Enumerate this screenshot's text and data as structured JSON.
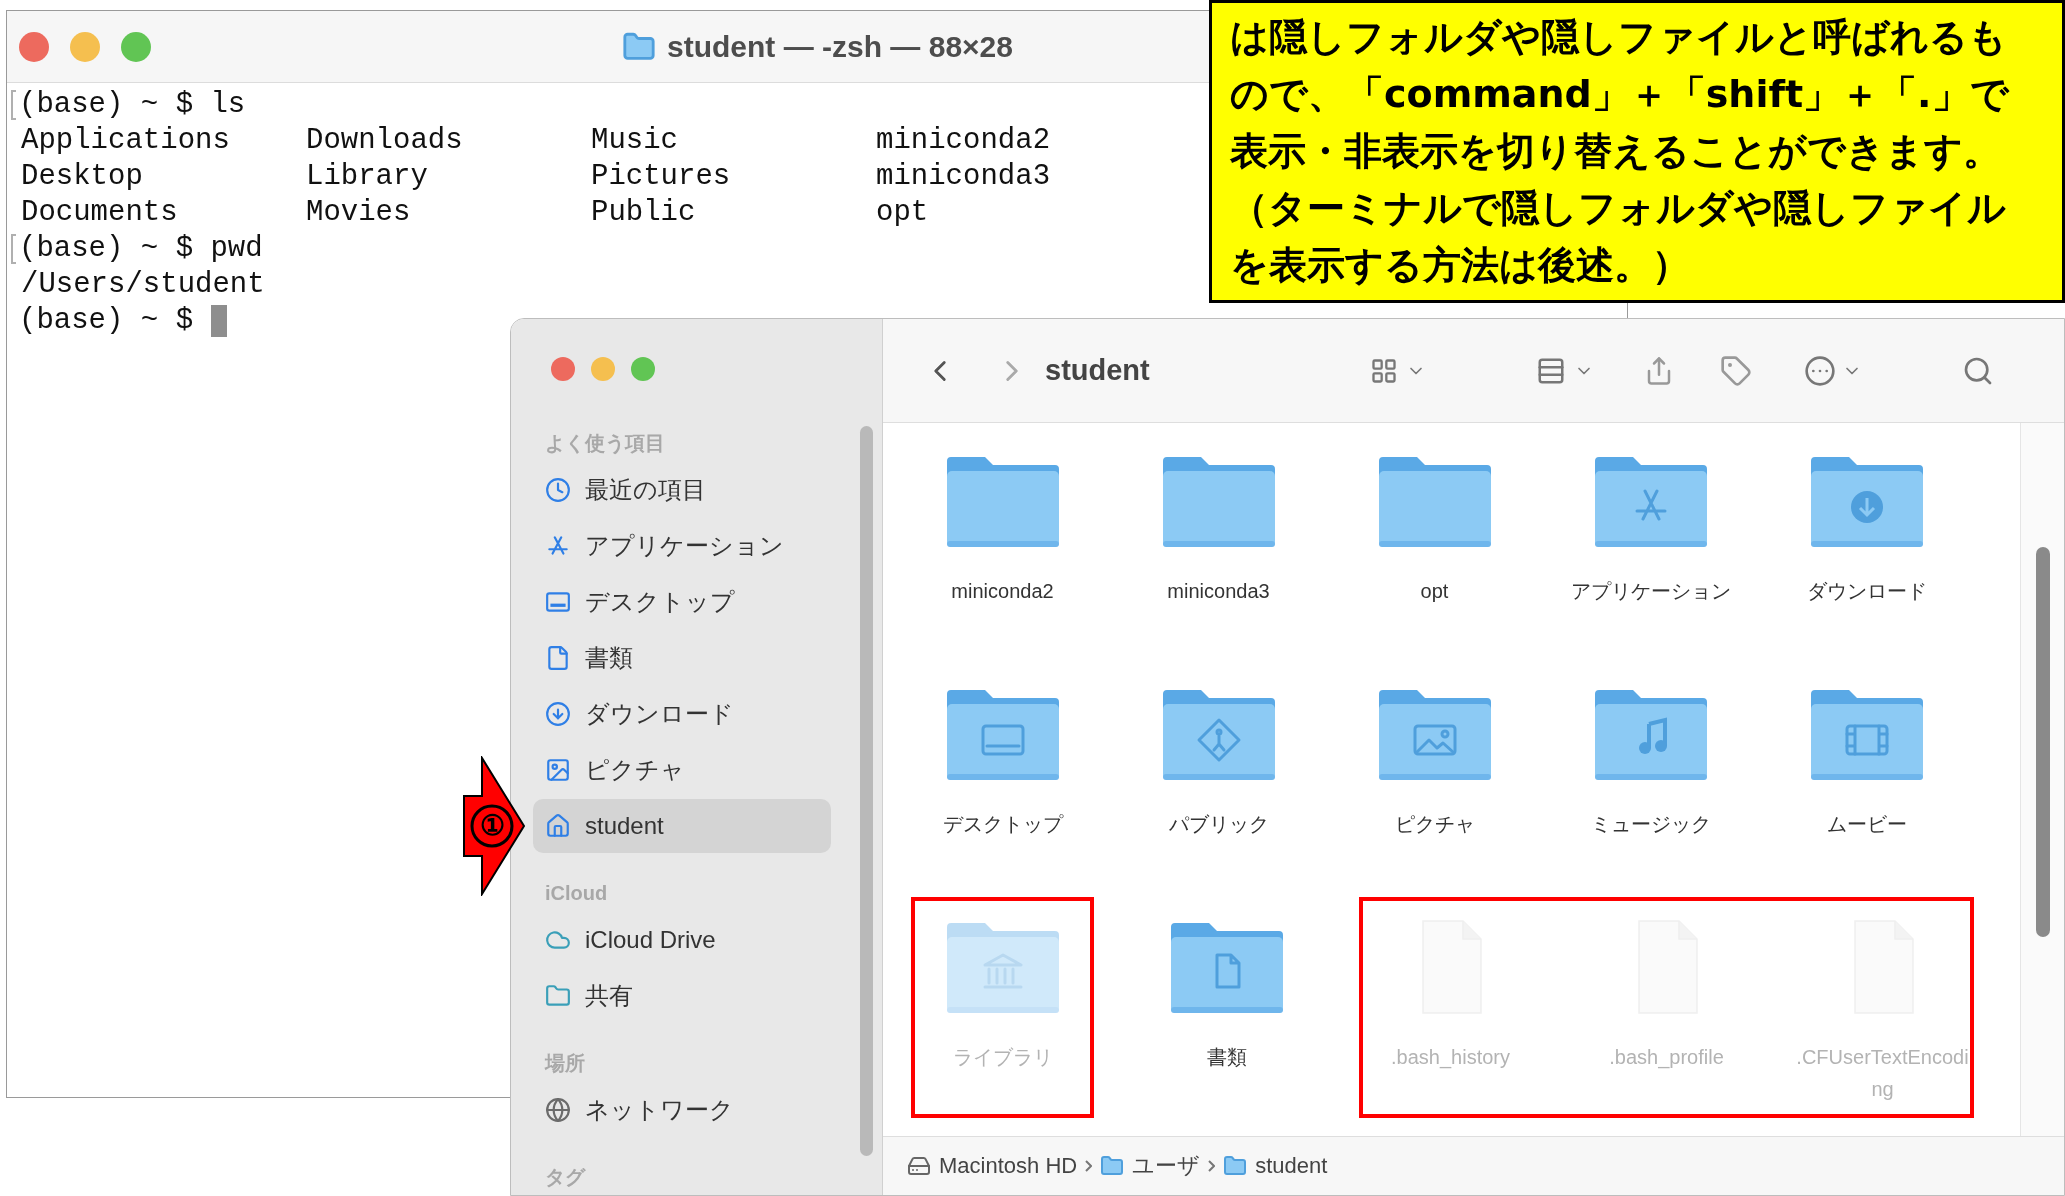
{
  "terminal": {
    "title": "student — -zsh — 88×28",
    "lines": [
      {
        "kind": "prompt",
        "prompt": "(base) ~ $",
        "command": "ls",
        "marked": true,
        "cursor": false
      },
      {
        "kind": "columns",
        "cells": [
          "Applications",
          "Downloads",
          "Music",
          "miniconda2"
        ]
      },
      {
        "kind": "columns",
        "cells": [
          "Desktop",
          "Library",
          "Pictures",
          "miniconda3"
        ]
      },
      {
        "kind": "columns",
        "cells": [
          "Documents",
          "Movies",
          "Public",
          "opt"
        ]
      },
      {
        "kind": "prompt",
        "prompt": "(base) ~ $",
        "command": "pwd",
        "marked": true,
        "cursor": false
      },
      {
        "kind": "output",
        "text": "/Users/student"
      },
      {
        "kind": "prompt",
        "prompt": "(base) ~ $",
        "marked": false,
        "cursor": true
      }
    ]
  },
  "finder": {
    "title": "student",
    "sidebar": {
      "sections": [
        {
          "label": "よく使う項目",
          "items": [
            {
              "label": "最近の項目",
              "selected": false
            },
            {
              "label": "アプリケーション",
              "selected": false
            },
            {
              "label": "デスクトップ",
              "selected": false
            },
            {
              "label": "書類",
              "selected": false
            },
            {
              "label": "ダウンロード",
              "selected": false
            },
            {
              "label": "ピクチャ",
              "selected": false
            },
            {
              "label": "student",
              "selected": true
            }
          ]
        },
        {
          "label": "iCloud",
          "items": [
            {
              "label": "iCloud Drive",
              "selected": false
            },
            {
              "label": "共有",
              "selected": false
            }
          ]
        },
        {
          "label": "場所",
          "items": [
            {
              "label": "ネットワーク",
              "selected": false
            }
          ]
        },
        {
          "label": "タグ"
        }
      ]
    },
    "rows": [
      {
        "groups": [
          {
            "highlighted": false,
            "items": [
              {
                "name": "miniconda2",
                "kind": "folder",
                "hidden": false
              },
              {
                "name": "miniconda3",
                "kind": "folder",
                "hidden": false
              },
              {
                "name": "opt",
                "kind": "folder",
                "hidden": false
              },
              {
                "name": "アプリケーション",
                "kind": "folder",
                "hidden": false
              },
              {
                "name": "ダウンロード",
                "kind": "folder",
                "hidden": false
              }
            ]
          }
        ]
      },
      {
        "groups": [
          {
            "highlighted": false,
            "items": [
              {
                "name": "デスクトップ",
                "kind": "folder",
                "hidden": false
              },
              {
                "name": "パブリック",
                "kind": "folder",
                "hidden": false
              },
              {
                "name": "ピクチャ",
                "kind": "folder",
                "hidden": false
              },
              {
                "name": "ミュージック",
                "kind": "folder",
                "hidden": false
              },
              {
                "name": "ムービー",
                "kind": "folder",
                "hidden": false
              }
            ]
          }
        ]
      },
      {
        "groups": [
          {
            "highlighted": true,
            "items": [
              {
                "name": "ライブラリ",
                "kind": "folder",
                "hidden": true
              }
            ]
          },
          {
            "highlighted": false,
            "items": [
              {
                "name": "書類",
                "kind": "folder",
                "hidden": false
              }
            ]
          },
          {
            "highlighted": true,
            "items": [
              {
                "name": ".bash_history",
                "kind": "file",
                "hidden": true
              },
              {
                "name": ".bash_profile",
                "kind": "file",
                "hidden": true
              },
              {
                "name": ".CFUserTextEncoding",
                "kind": "file",
                "hidden": true
              }
            ]
          }
        ]
      }
    ],
    "path": [
      {
        "label": "Macintosh HD"
      },
      {
        "label": "ユーザ"
      },
      {
        "label": "student"
      }
    ]
  },
  "annotations": {
    "callout": "は隠しフォルダや隠しファイルと呼ばれるもので、「command」＋「shift」＋「.」で表示・非表示を切り替えることができます。（ターミナルで隠しフォルダや隠しファイルを表示する方法は後述。）",
    "arrow_marker": "①"
  }
}
